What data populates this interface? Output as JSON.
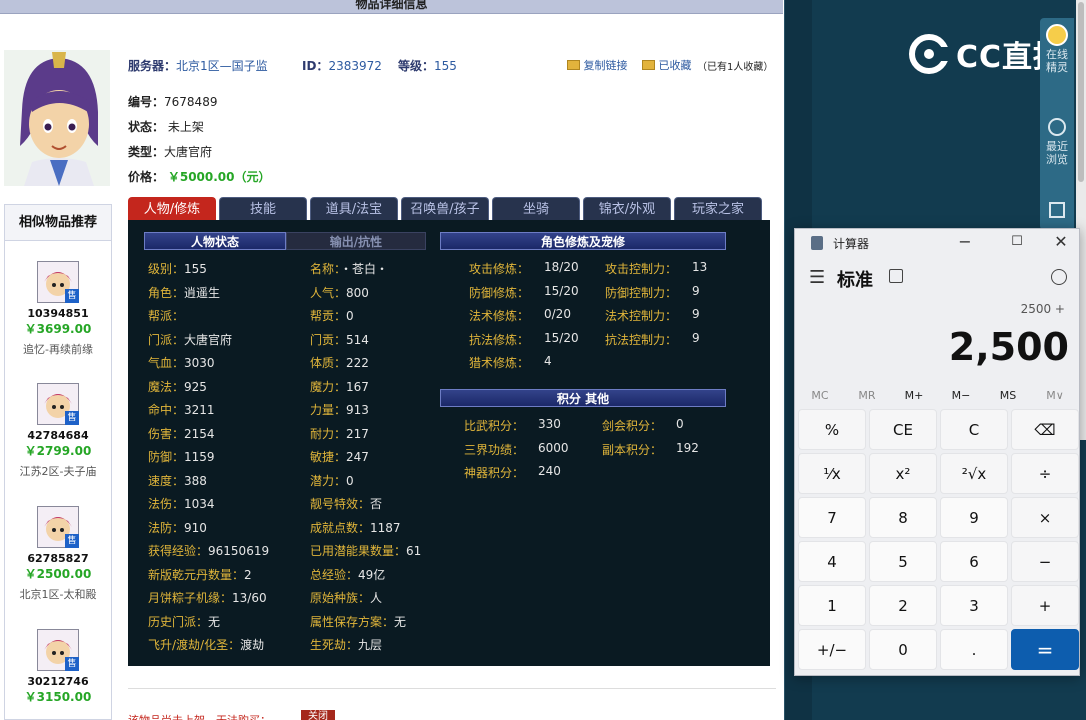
{
  "page": {
    "title": "物品详细信息"
  },
  "info": {
    "server_label": "服务器：",
    "server": "北京1区—国子监",
    "id_label": "ID：",
    "id": "2383972",
    "level_label": "等级：",
    "level": "155",
    "copy_link": "复制链接",
    "collected": "已收藏",
    "collect_count": "（已有1人收藏）",
    "number_label": "编号：",
    "number": "7678489",
    "status_label": "状态：",
    "status": "未上架",
    "type_label": "类型：",
    "type": "大唐官府",
    "price_label": "价格：",
    "price": "￥5000.00（元）"
  },
  "similar": {
    "title": "相似物品推荐",
    "sale_tag": "售",
    "items": [
      {
        "id": "10394851",
        "price": "￥3699.00",
        "server": "追忆-再续前缘"
      },
      {
        "id": "42784684",
        "price": "￥2799.00",
        "server": "江苏2区-夫子庙"
      },
      {
        "id": "62785827",
        "price": "￥2500.00",
        "server": "北京1区-太和殿"
      },
      {
        "id": "30212746",
        "price": "￥3150.00",
        "server": ""
      }
    ]
  },
  "tabs": [
    "人物/修炼",
    "技能",
    "道具/法宝",
    "召唤兽/孩子",
    "坐骑",
    "锦衣/外观",
    "玩家之家"
  ],
  "panel": {
    "hdr_status": "人物状态",
    "hdr_output": "输出/抗性",
    "hdr_train": "角色修炼及宠修",
    "hdr_points": "积分  其他",
    "col1": [
      [
        "级别：",
        "155"
      ],
      [
        "角色：",
        "逍遥生"
      ],
      [
        "帮派：",
        ""
      ],
      [
        "门派：",
        "大唐官府"
      ],
      [
        "气血：",
        "3030"
      ],
      [
        "魔法：",
        "925"
      ],
      [
        "命中：",
        "3211"
      ],
      [
        "伤害：",
        "2154"
      ],
      [
        "防御：",
        "1159"
      ],
      [
        "速度：",
        "388"
      ],
      [
        "法伤：",
        "1034"
      ],
      [
        "法防：",
        "910"
      ],
      [
        "获得经验：",
        "96150619"
      ],
      [
        "新版乾元丹数量：",
        "2"
      ],
      [
        "月饼粽子机缘：",
        "13/60"
      ],
      [
        "历史门派：",
        "无"
      ],
      [
        "飞升/渡劫/化圣：",
        "渡劫"
      ]
    ],
    "col2": [
      [
        "名称：",
        "・苍白・"
      ],
      [
        "人气：",
        "800"
      ],
      [
        "帮贡：",
        "0"
      ],
      [
        "门贡：",
        "514"
      ],
      [
        "体质：",
        "222"
      ],
      [
        "魔力：",
        "167"
      ],
      [
        "力量：",
        "913"
      ],
      [
        "耐力：",
        "217"
      ],
      [
        "敏捷：",
        "247"
      ],
      [
        "潜力：",
        "0"
      ],
      [
        "靓号特效：",
        "否"
      ],
      [
        "成就点数：",
        "1187"
      ],
      [
        "已用潜能果数量：",
        "61"
      ],
      [
        "总经验：",
        "49亿"
      ],
      [
        "原始种族：",
        "人"
      ],
      [
        "属性保存方案：",
        "无"
      ],
      [
        "生死劫：",
        "九层"
      ]
    ],
    "train": [
      [
        "攻击修炼：",
        "18/20",
        "攻击控制力：",
        "13"
      ],
      [
        "防御修炼：",
        "15/20",
        "防御控制力：",
        "9"
      ],
      [
        "法术修炼：",
        "0/20",
        "法术控制力：",
        "9"
      ],
      [
        "抗法修炼：",
        "15/20",
        "抗法控制力：",
        "9"
      ],
      [
        "猎术修炼：",
        "4",
        "",
        ""
      ]
    ],
    "points": [
      [
        "比武积分：",
        "330",
        "剑会积分：",
        "0"
      ],
      [
        "三界功绩：",
        "6000",
        "副本积分：",
        "192"
      ],
      [
        "神器积分：",
        "240",
        "",
        ""
      ]
    ]
  },
  "bottom": {
    "notice": "该物品尚未上架，无法购买：",
    "btn": "关闭"
  },
  "cc": {
    "logo": "CC直播",
    "side": [
      {
        "label1": "在线",
        "label2": "精灵"
      },
      {
        "label1": "最近",
        "label2": "浏览"
      }
    ]
  },
  "calc": {
    "title": "计算器",
    "mode": "标准",
    "expression": "2500 +",
    "display": "2,500",
    "memory": [
      "MC",
      "MR",
      "M+",
      "M−",
      "MS",
      "M∨"
    ],
    "keys": [
      [
        "%",
        "CE",
        "C",
        "⌫"
      ],
      [
        "¹⁄x",
        "x²",
        "²√x",
        "÷"
      ],
      [
        "7",
        "8",
        "9",
        "×"
      ],
      [
        "4",
        "5",
        "6",
        "−"
      ],
      [
        "1",
        "2",
        "3",
        "+"
      ],
      [
        "+/−",
        "0",
        ".",
        "="
      ]
    ]
  }
}
